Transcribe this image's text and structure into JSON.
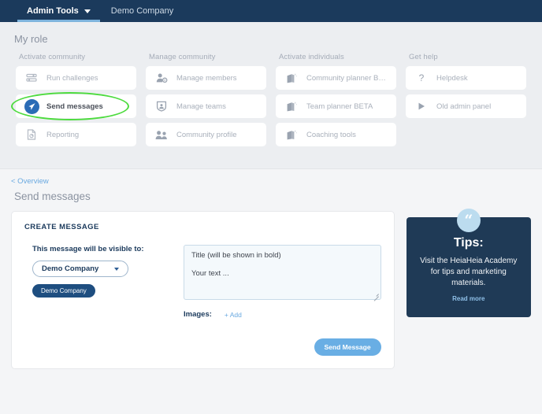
{
  "topnav": {
    "tabs": [
      {
        "label": "Admin Tools",
        "icon": "chevron-down-icon",
        "active": true
      },
      {
        "label": "Demo Company",
        "active": false
      }
    ]
  },
  "role_panel": {
    "title": "My role",
    "columns": [
      {
        "heading": "Activate community",
        "items": [
          {
            "label": "Run challenges",
            "icon": "sliders-icon",
            "highlight": false
          },
          {
            "label": "Send messages",
            "icon": "send-message-icon",
            "highlight": true
          },
          {
            "label": "Reporting",
            "icon": "report-document-icon",
            "highlight": false
          }
        ]
      },
      {
        "heading": "Manage community",
        "items": [
          {
            "label": "Manage members",
            "icon": "person-gear-icon",
            "highlight": false
          },
          {
            "label": "Manage teams",
            "icon": "team-shield-icon",
            "highlight": false
          },
          {
            "label": "Community profile",
            "icon": "two-people-icon",
            "highlight": false
          }
        ]
      },
      {
        "heading": "Activate individuals",
        "items": [
          {
            "label": "Community planner BETA",
            "icon": "planner-sparkle-icon",
            "highlight": false
          },
          {
            "label": "Team planner BETA",
            "icon": "planner-sparkle-icon",
            "highlight": false
          },
          {
            "label": "Coaching tools",
            "icon": "planner-sparkle-icon",
            "highlight": false
          }
        ]
      },
      {
        "heading": "Get help",
        "items": [
          {
            "label": "Helpdesk",
            "icon": "question-mark-icon",
            "highlight": false
          },
          {
            "label": "Old admin panel",
            "icon": "play-triangle-icon",
            "highlight": false
          }
        ]
      }
    ]
  },
  "lower": {
    "breadcrumb": "< Overview",
    "page_title": "Send messages",
    "form": {
      "card_heading": "CREATE MESSAGE",
      "visible_to_label": "This message will be visible to:",
      "dropdown_value": "Demo Company",
      "chip_label": "Demo Company",
      "message_title_placeholder": "Title (will be shown in bold)",
      "message_body_placeholder": "Your text ...",
      "images_label": "Images:",
      "add_image_label": "+ Add",
      "send_button_label": "Send Message"
    },
    "tips": {
      "quote_glyph": "“",
      "title": "Tips:",
      "body": "Visit the HeiaHeia Academy for tips and marketing materials.",
      "link": "Read more"
    }
  },
  "colors": {
    "navbar": "#1b3a5c",
    "nav_active_underline": "#7fb4dd",
    "page_bg": "#f4f5f7",
    "role_panel_bg": "#eceef1",
    "accent_blue": "#69aee4",
    "link_blue": "#6aa9e0",
    "chip_navy": "#1e4e80",
    "tips_bg": "#1f3a56",
    "marker_green": "#4ddb3e",
    "send_icon_blue": "#2b6cb6"
  }
}
